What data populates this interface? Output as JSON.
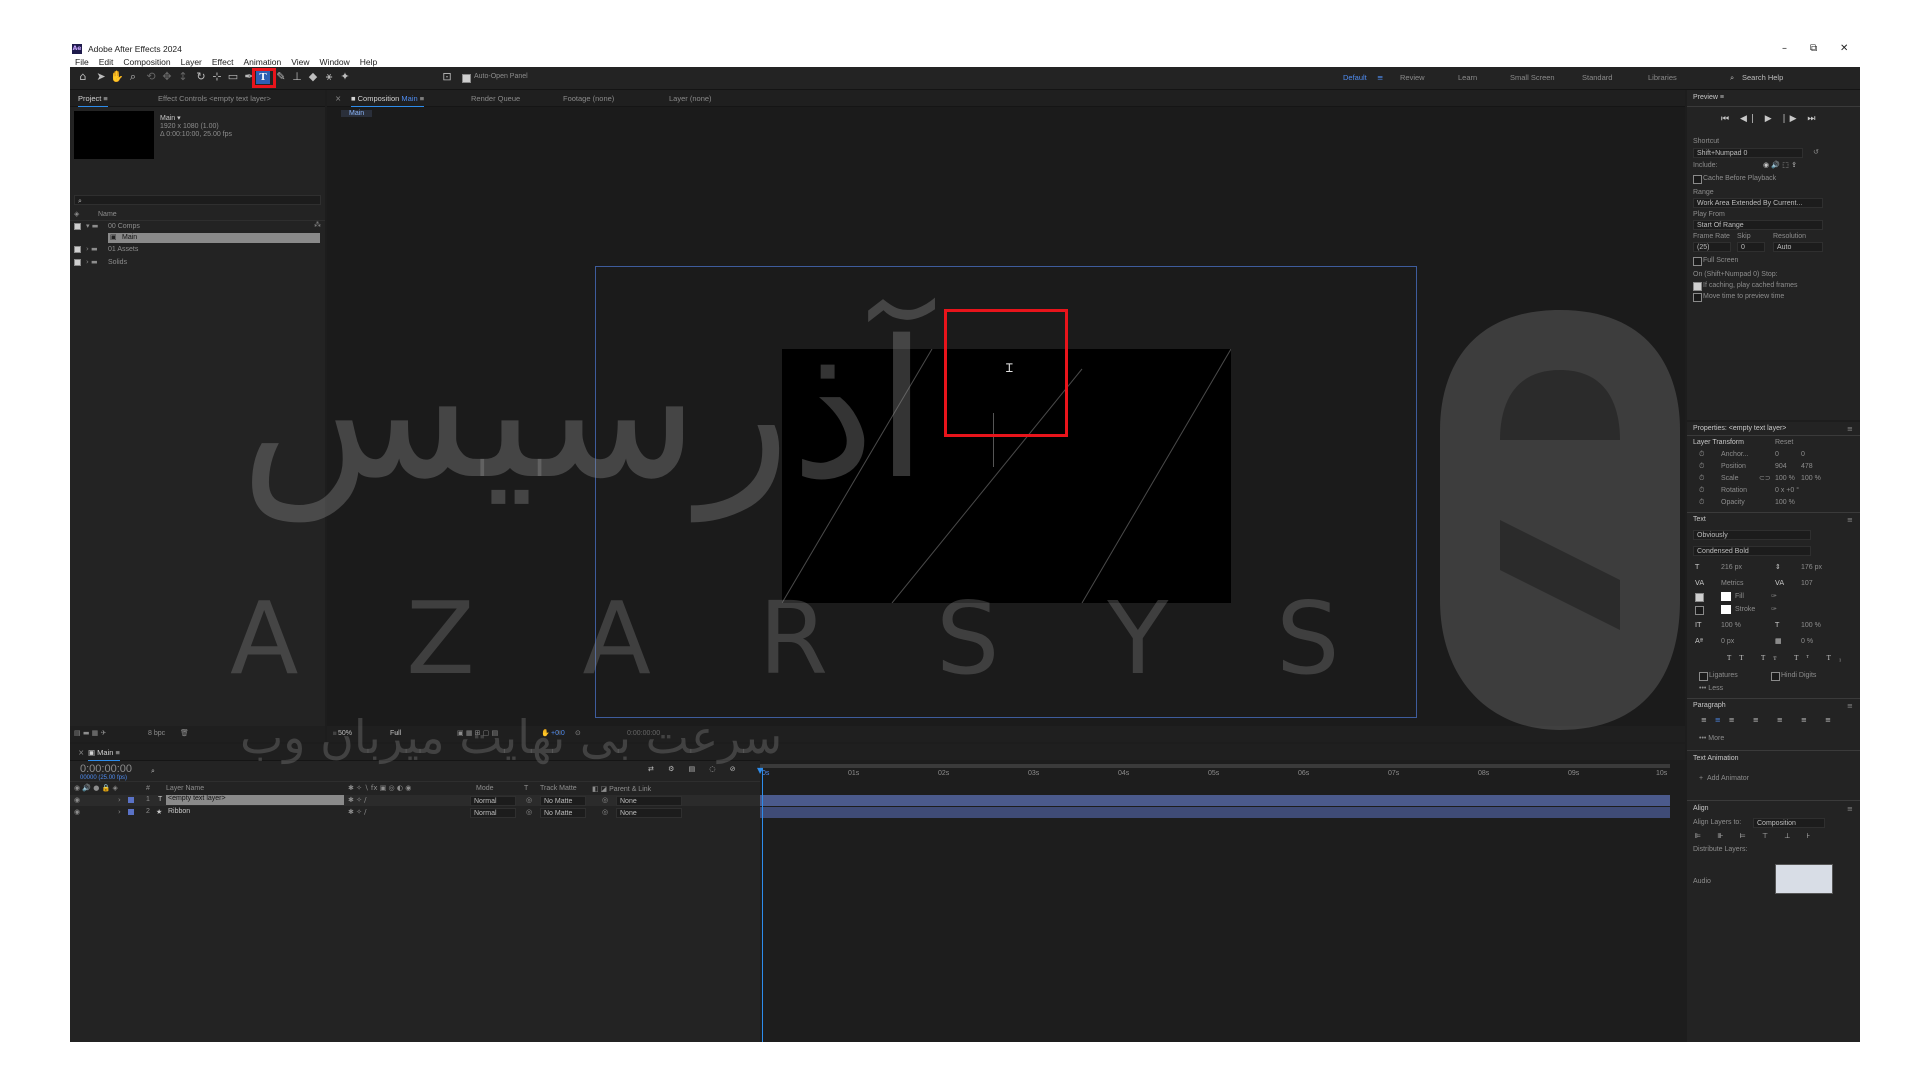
{
  "app": {
    "title": "Adobe After Effects 2024",
    "logo_text": "Ae"
  },
  "menu": [
    "File",
    "Edit",
    "Composition",
    "Layer",
    "Effect",
    "Animation",
    "View",
    "Window",
    "Help"
  ],
  "toolbar": {
    "auto_open_panel": "Auto-Open Panel",
    "workspaces": [
      "Default",
      "Review",
      "Learn",
      "Small Screen",
      "Standard",
      "Libraries"
    ],
    "workspace_active_index": 0,
    "search_help": "Search Help",
    "highlight_color": "#e8141b"
  },
  "project_panel": {
    "tab_project": "Project",
    "tab_effect_controls": "Effect Controls <empty text layer>",
    "comp_name": "Main ▾",
    "comp_resolution": "1920 x 1080 (1.00)",
    "comp_duration": "Δ 0:00:10:00, 25.00 fps",
    "col_name": "Name",
    "items": [
      {
        "name": "00 Comps",
        "type": "folder"
      },
      {
        "name": "Main",
        "type": "comp",
        "selected": true
      },
      {
        "name": "01 Assets",
        "type": "folder"
      },
      {
        "name": "Solids",
        "type": "folder"
      }
    ]
  },
  "composition_panel": {
    "tab_composition": "Composition",
    "tab_comp_name": "Main",
    "tab_render_queue": "Render Queue",
    "tab_footage": "Footage",
    "tab_footage_value": "(none)",
    "tab_layer": "Layer",
    "tab_layer_value": "(none)",
    "breadcrumb": "Main",
    "zoom": "50%",
    "resolution": "Full",
    "exposure": "+0.0",
    "timecode": "0:00:00:00"
  },
  "timeline": {
    "tab_name": "Main",
    "current_time": "0:00:00:00",
    "frame_info": "00000 (25.00 fps)",
    "col_layer_name": "Layer Name",
    "col_mode": "Mode",
    "col_t": "T",
    "col_track_matte": "Track Matte",
    "col_parent": "Parent & Link",
    "ruler": [
      "0s",
      "01s",
      "02s",
      "03s",
      "04s",
      "05s",
      "06s",
      "07s",
      "08s",
      "09s",
      "10s"
    ],
    "bpc": "8 bpc",
    "layers": [
      {
        "num": "1",
        "icon": "T",
        "name": "<empty text layer>",
        "mode": "Normal",
        "matte": "No Matte",
        "parent": "None",
        "selected": true
      },
      {
        "num": "2",
        "icon": "★",
        "name": "Ribbon",
        "mode": "Normal",
        "matte": "No Matte",
        "parent": "None",
        "selected": false
      }
    ]
  },
  "preview_panel": {
    "title": "Preview",
    "shortcut_label": "Shortcut",
    "shortcut_value": "Shift+Numpad 0",
    "include_label": "Include:",
    "cache_before": "Cache Before Playback",
    "range_label": "Range",
    "range_value": "Work Area Extended By Current...",
    "play_from_label": "Play From",
    "play_from_value": "Start Of Range",
    "frame_rate_label": "Frame Rate",
    "skip_label": "Skip",
    "resolution_label": "Resolution",
    "frame_rate_value": "(25)",
    "skip_value": "0",
    "resolution_value": "Auto",
    "full_screen": "Full Screen",
    "on_stop": "On (Shift+Numpad 0) Stop:",
    "if_caching": "If caching, play cached frames",
    "move_time": "Move time to preview time"
  },
  "properties_panel": {
    "title": "Properties: <empty text layer>",
    "layer_transform": "Layer Transform",
    "reset": "Reset",
    "anchor_label": "Anchor...",
    "anchor_x": "0",
    "anchor_y": "0",
    "position_label": "Position",
    "position_x": "904",
    "position_y": "478",
    "scale_label": "Scale",
    "scale_x": "100 %",
    "scale_y": "100 %",
    "rotation_label": "Rotation",
    "rotation_value": "0 x +0 °",
    "opacity_label": "Opacity",
    "opacity_value": "100 %",
    "text_section": "Text",
    "font_family": "Obviously",
    "font_style": "Condensed Bold",
    "font_size": "216 px",
    "leading": "176 px",
    "kerning": "Metrics",
    "tracking": "107",
    "fill_label": "Fill",
    "stroke_label": "Stroke",
    "vert_scale": "100 %",
    "horiz_scale": "100 %",
    "baseline": "0 px",
    "tsume": "0 %",
    "ligatures": "Ligatures",
    "hindi_digits": "Hindi Digits",
    "less": "Less",
    "paragraph": "Paragraph",
    "more": "More",
    "text_animation": "Text Animation",
    "add_animator": "Add Animator",
    "align": "Align",
    "align_layers_to": "Align Layers to:",
    "align_target": "Composition",
    "distribute_layers": "Distribute Layers:",
    "audio": "Audio"
  },
  "watermark": {
    "latin": "A Z A R S Y S",
    "persian_large": "آذرسیس",
    "persian_small": "سرعت بی نهایت میزبان وب"
  }
}
